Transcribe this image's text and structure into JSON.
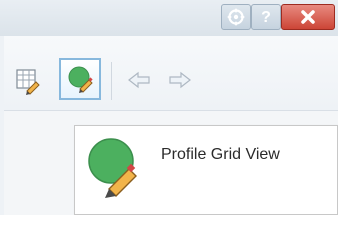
{
  "title_bar": {
    "buttons": [
      {
        "name": "help-gear",
        "icon": "gear-help-icon"
      },
      {
        "name": "help",
        "icon": "question-icon",
        "label": "?"
      },
      {
        "name": "close",
        "icon": "close-icon"
      }
    ],
    "colors": {
      "close_red": "#cc4536",
      "button_blue": "#c6d3df"
    }
  },
  "toolbar": {
    "items": [
      {
        "name": "grid-edit",
        "icon": "grid-pencil-icon"
      },
      {
        "name": "profile-grid-view",
        "icon": "green-circle-pencil-icon",
        "selected": true
      },
      {
        "name": "back",
        "icon": "back-arrow-icon",
        "disabled": true
      },
      {
        "name": "forward",
        "icon": "forward-arrow-icon",
        "disabled": true
      }
    ]
  },
  "tooltip": {
    "title": "Profile Grid View",
    "icon": "green-circle-pencil-icon",
    "accent_color": "#4cb05f"
  }
}
